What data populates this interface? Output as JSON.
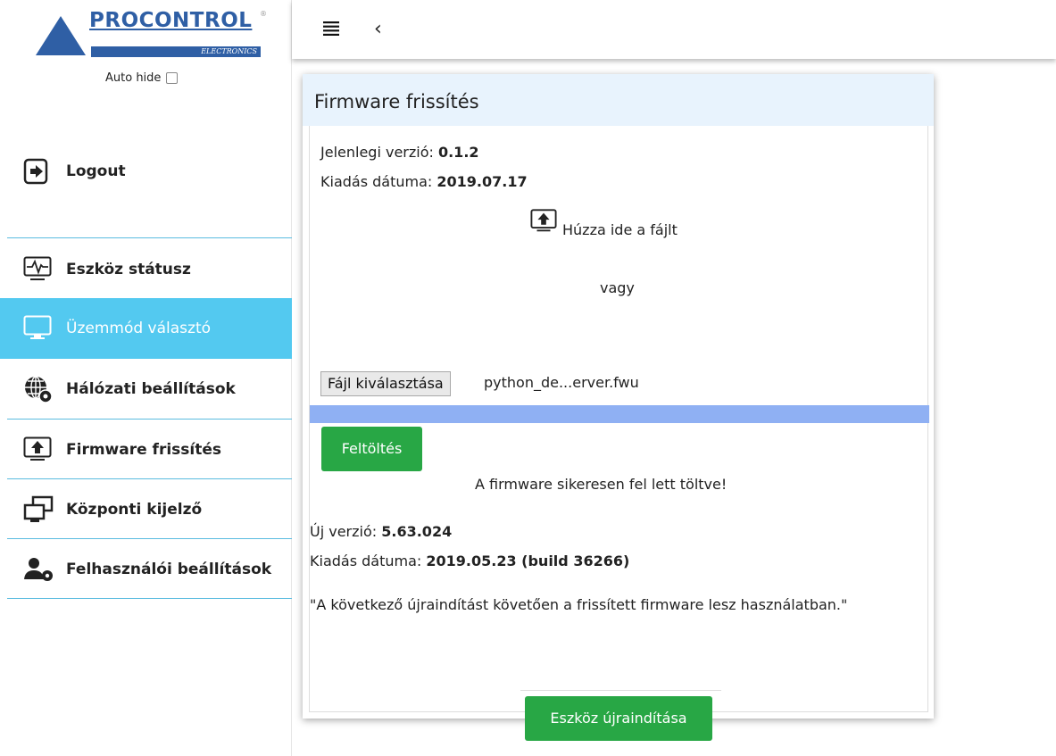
{
  "logo": {
    "text": "PROCONTROL",
    "sub": "ELECTRONICS",
    "reg": "®"
  },
  "autohide": {
    "label": "Auto hide"
  },
  "sidebar": {
    "items": [
      {
        "label": "Logout",
        "icon": "logout-icon"
      },
      {
        "label": "Eszköz státusz",
        "icon": "monitor-pulse-icon"
      },
      {
        "label": "Üzemmód választó",
        "icon": "monitor-icon",
        "active": true
      },
      {
        "label": "Hálózati beállítások",
        "icon": "globe-gear-icon"
      },
      {
        "label": "Firmware frissítés",
        "icon": "monitor-upload-icon"
      },
      {
        "label": "Központi kijelző",
        "icon": "dual-monitor-icon"
      },
      {
        "label": "Felhasználói beállítások",
        "icon": "user-gear-icon"
      }
    ]
  },
  "topbar": {
    "menu_icon": "hamburger-icon",
    "back_icon": "chevron-left-icon",
    "back": "‹"
  },
  "card": {
    "title": "Firmware frissítés",
    "current_version_label": "Jelenlegi verzió: ",
    "current_version": "0.1.2",
    "release_label": "Kiadás dátuma: ",
    "release_date": "2019.07.17",
    "drop_text": "Húzza ide a fájlt",
    "or_text": "vagy",
    "file_button": "Fájl kiválasztása",
    "file_name": "python_de...erver.fwu",
    "upload_progress": 1.0,
    "upload_button": "Feltöltés",
    "success_message": "A firmware sikeresen fel lett töltve!",
    "new_version_label": "Új verzió: ",
    "new_version": "5.63.024",
    "new_release_label": "Kiadás dátuma: ",
    "new_release_date": "2019.05.23 (build 36266)",
    "notice": "\"A következő újraindítást követően a frissített firmware lesz használatban.\"",
    "restart_button": "Eszköz újraindítása"
  },
  "colors": {
    "accent": "#53c9f0",
    "green": "#28a745",
    "progress": "#8fb0f3",
    "header_bg": "#e8f3fd",
    "logo_blue": "#2f5fa5"
  }
}
